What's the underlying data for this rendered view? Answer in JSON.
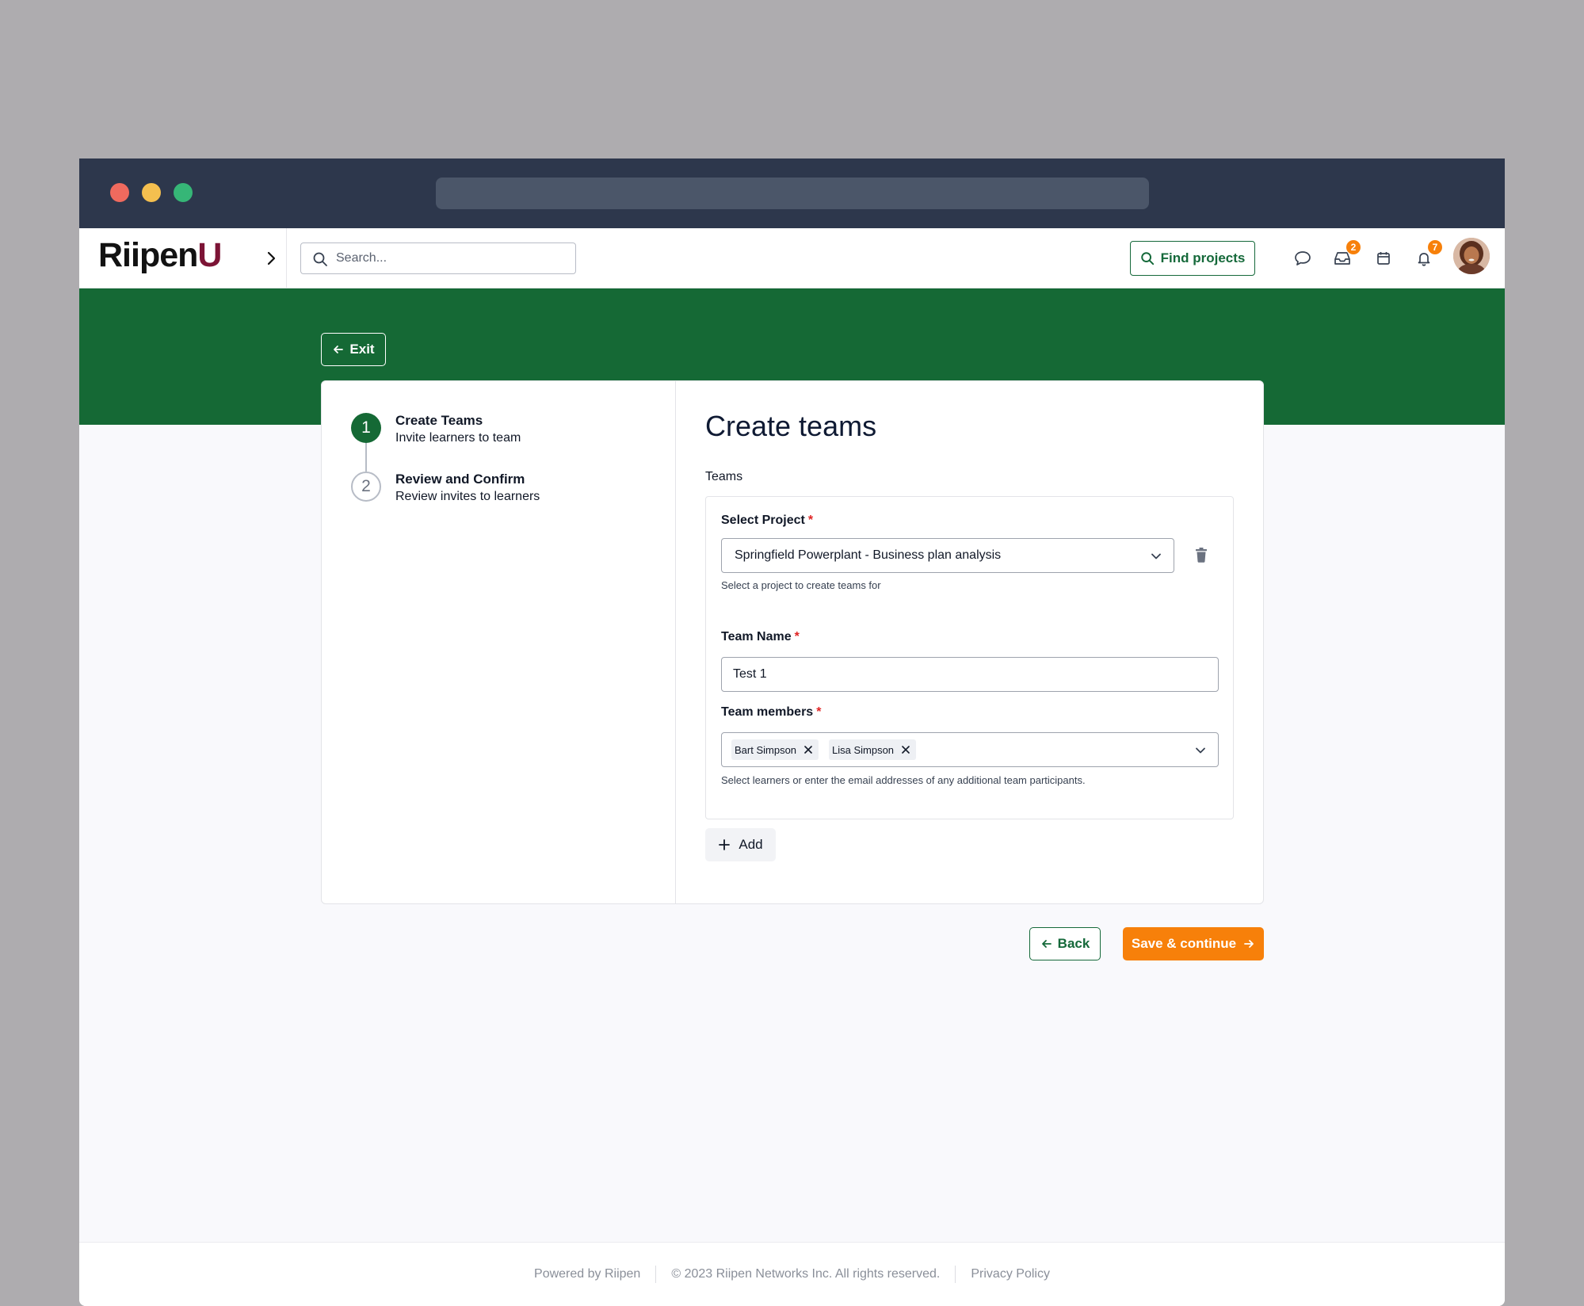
{
  "header": {
    "logo_main": "Riipen",
    "logo_accent": "U",
    "search_placeholder": "Search...",
    "find_projects_label": "Find projects",
    "inbox_badge": "2",
    "notifications_badge": "7"
  },
  "banner": {
    "exit_label": "Exit"
  },
  "stepper": {
    "steps": [
      {
        "number": "1",
        "title": "Create Teams",
        "subtitle": "Invite learners to team"
      },
      {
        "number": "2",
        "title": "Review and Confirm",
        "subtitle": "Review invites to learners"
      }
    ]
  },
  "form": {
    "title": "Create teams",
    "section_label": "Teams",
    "project": {
      "label": "Select Project",
      "required_mark": "*",
      "value": "Springfield Powerplant - Business plan analysis",
      "help": "Select a project to create teams for"
    },
    "team_name": {
      "label": "Team Name",
      "required_mark": "*",
      "value": "Test 1"
    },
    "team_members": {
      "label": "Team members",
      "required_mark": "*",
      "chips": [
        "Bart Simpson",
        "Lisa Simpson"
      ],
      "help": "Select learners or enter the email addresses of any additional team participants."
    },
    "add_label": "Add"
  },
  "actions": {
    "back_label": "Back",
    "save_label": "Save & continue"
  },
  "footer": {
    "powered_by": "Powered by Riipen",
    "copyright": "© 2023 Riipen Networks Inc. All rights reserved.",
    "privacy": "Privacy Policy"
  },
  "colors": {
    "brand_green": "#156935",
    "accent_orange": "#f7800a",
    "logo_maroon": "#7c1435",
    "titlebar": "#2d374c"
  }
}
